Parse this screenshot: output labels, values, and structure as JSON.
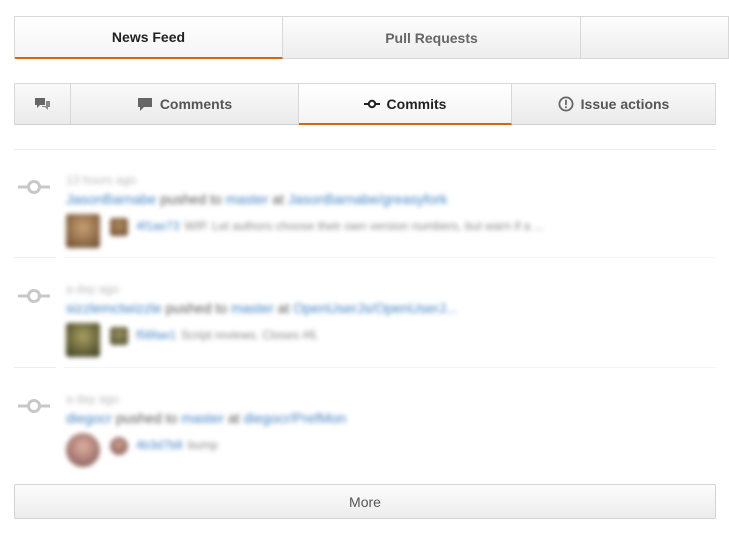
{
  "top_tabs": [
    {
      "label": "News Feed"
    },
    {
      "label": "Pull Requests"
    },
    {
      "label": ""
    }
  ],
  "sub_tabs": [
    {
      "label": "",
      "icon": "discussion-icon"
    },
    {
      "label": "Comments",
      "icon": "comment-icon"
    },
    {
      "label": "Commits",
      "icon": "commit-icon"
    },
    {
      "label": "Issue actions",
      "icon": "issue-icon"
    }
  ],
  "feed": [
    {
      "time": "13 hours ago",
      "user": "JasonBarnabe",
      "verb": "pushed to",
      "branch": "master",
      "at": "at",
      "repo": "JasonBarnabe/greasyfork",
      "sha": "4f1ae73",
      "message": "WIP. Let authors choose their own version numbers, but warn if a ...",
      "avatar_color": "#8a6a45",
      "small_avatar_color": "#9a7a55"
    },
    {
      "time": "a day ago",
      "user": "sizzlemctwizzle",
      "verb": "pushed to",
      "branch": "master",
      "at": "at",
      "repo": "OpenUserJs/OpenUserJ...",
      "sha": "f56fae1",
      "message": "Script reviews. Closes #6.",
      "avatar_color": "#5b5a2e",
      "small_avatar_color": "#6b6a3e"
    },
    {
      "time": "a day ago",
      "user": "diegocr",
      "verb": "pushed to",
      "branch": "master",
      "at": "at",
      "repo": "diegocr/PrefMon",
      "sha": "4b3d7b8",
      "message": "bump",
      "avatar_color": "#b07070",
      "small_avatar_color": "#9a6a6a"
    }
  ],
  "more_label": "More",
  "colors": {
    "accent": "#d26911",
    "link": "#4183c4"
  }
}
